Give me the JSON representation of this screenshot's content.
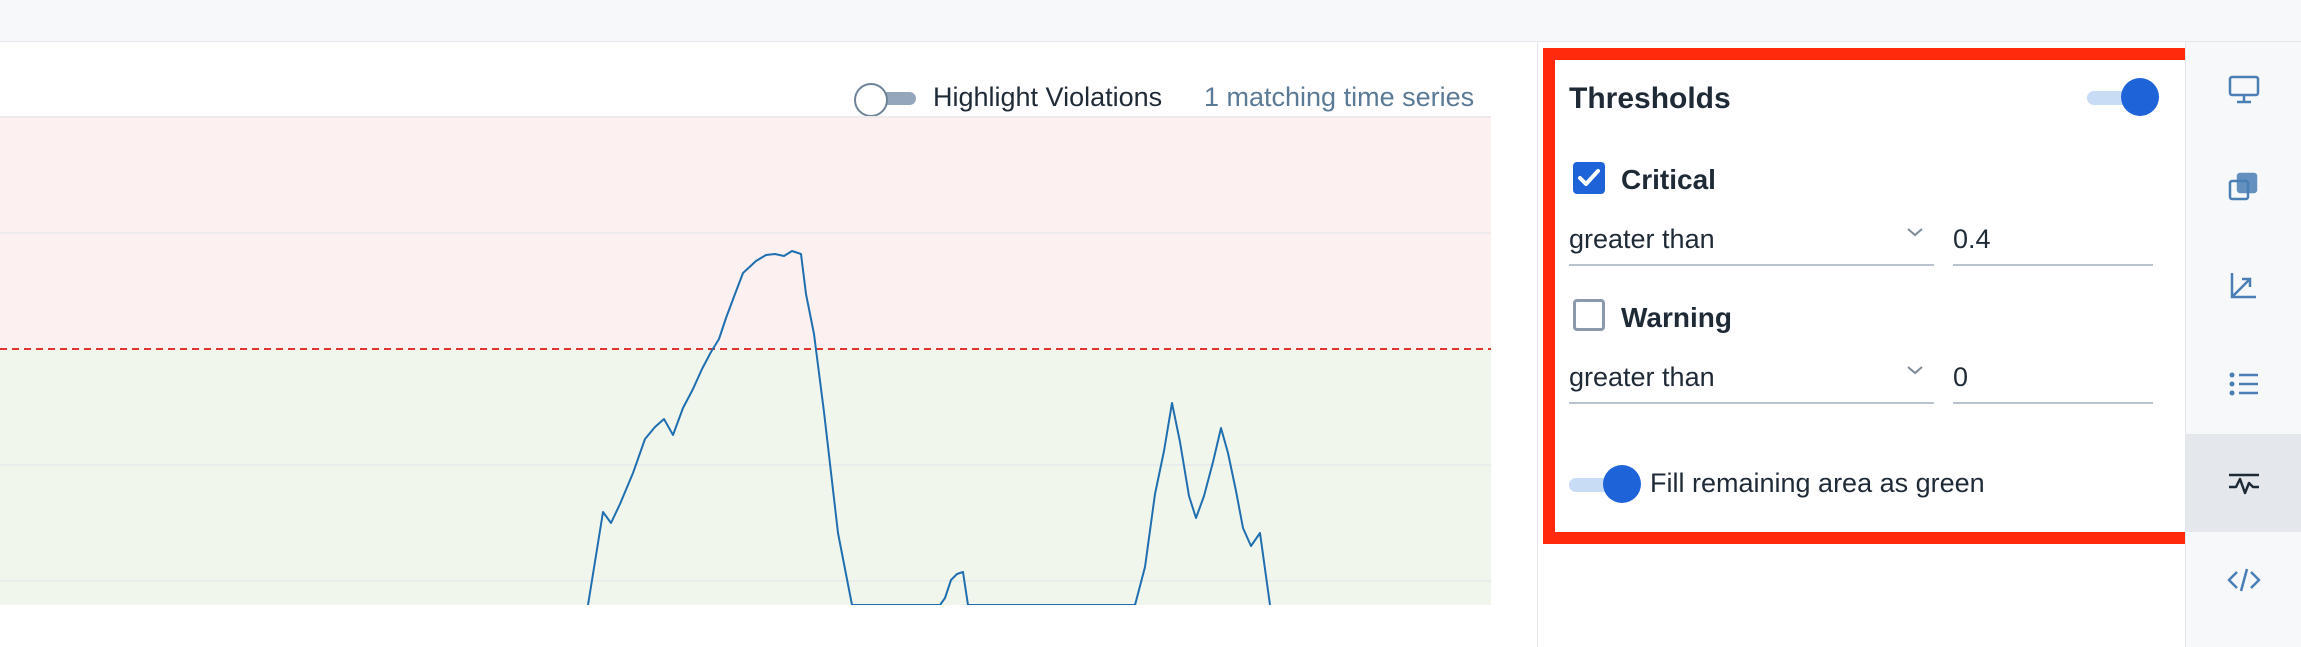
{
  "header": {
    "highlight_violations_label": "Highlight Violations",
    "highlight_violations_on": false,
    "matching_series_label": "1 matching time series"
  },
  "thresholds": {
    "title": "Thresholds",
    "enabled": true,
    "critical": {
      "label": "Critical",
      "checked": true,
      "operator": "greater than",
      "value": "0.4"
    },
    "warning": {
      "label": "Warning",
      "checked": false,
      "operator": "greater than",
      "value": "0"
    },
    "fill_remaining": {
      "label": "Fill remaining area as green",
      "enabled": true
    }
  },
  "colors": {
    "accent": "#1f63d8",
    "critical_region": "#fdf0f0",
    "ok_region": "#f1f6ec",
    "threshold_line": "#e0352b",
    "series_line": "#1f6fb0",
    "highlight_border": "#ff2a0c"
  },
  "rail": {
    "items": [
      {
        "icon": "monitor-icon",
        "active": false
      },
      {
        "icon": "layers-icon",
        "active": false
      },
      {
        "icon": "axes-icon",
        "active": false
      },
      {
        "icon": "legend-list-icon",
        "active": false
      },
      {
        "icon": "thresholds-icon",
        "active": true
      },
      {
        "icon": "code-icon",
        "active": false
      }
    ]
  }
}
